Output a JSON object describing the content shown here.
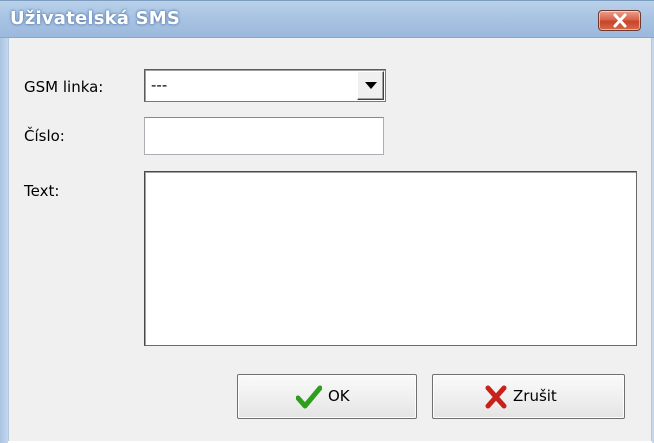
{
  "window": {
    "title": "Uživatelská SMS",
    "close_icon": "close-icon"
  },
  "form": {
    "gsm_label": "GSM linka:",
    "gsm_value": "---",
    "number_label": "Číslo:",
    "number_value": "",
    "text_label": "Text:",
    "text_value": ""
  },
  "buttons": {
    "ok_label": "OK",
    "ok_icon": "checkmark-icon",
    "cancel_label": "Zrušit",
    "cancel_icon": "red-x-icon"
  },
  "colors": {
    "titlebar": "#a9c4e3",
    "close_button": "#d8654c",
    "dialog_background": "#f0f0f0",
    "ok_icon": "#2e9e1e",
    "cancel_icon": "#c8201a"
  }
}
